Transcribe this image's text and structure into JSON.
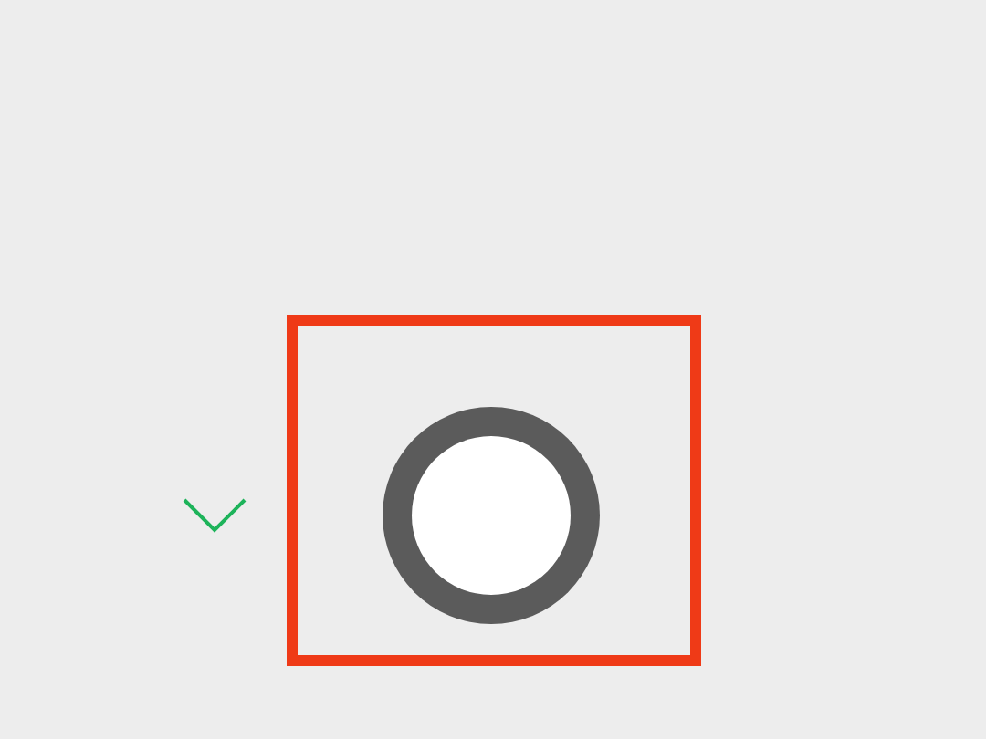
{
  "camera_controls": [
    {
      "kind": "chevron"
    },
    {
      "kind": "shutter"
    }
  ],
  "annotation": {
    "kind": "highlight"
  }
}
